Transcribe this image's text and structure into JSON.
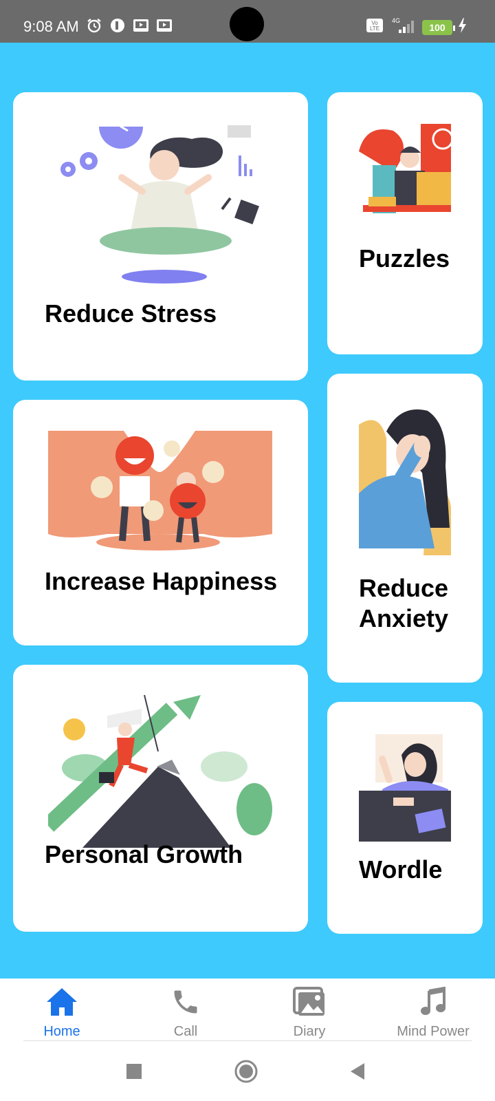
{
  "status_bar": {
    "time": "9:08 AM",
    "battery": "100",
    "network": "4G",
    "volte": "Vo LTE"
  },
  "cards": {
    "reduce_stress": {
      "title": "Reduce Stress",
      "illustration": "meditation-illustration"
    },
    "puzzles": {
      "title": "Puzzles",
      "illustration": "puzzle-desk-illustration"
    },
    "increase_happiness": {
      "title": "Increase Happiness",
      "illustration": "happy-emoji-illustration"
    },
    "reduce_anxiety": {
      "title": "Reduce Anxiety",
      "illustration": "anxious-woman-illustration"
    },
    "personal_growth": {
      "title": "Personal Growth",
      "illustration": "mountain-climb-illustration"
    },
    "wordle": {
      "title": "Wordle",
      "illustration": "reading-woman-illustration"
    }
  },
  "bottom_nav": [
    {
      "label": "Home",
      "icon": "home-icon",
      "active": true
    },
    {
      "label": "Call",
      "icon": "phone-icon",
      "active": false
    },
    {
      "label": "Diary",
      "icon": "gallery-icon",
      "active": false
    },
    {
      "label": "Mind Power",
      "icon": "music-note-icon",
      "active": false
    }
  ],
  "colors": {
    "background": "#3ECAFC",
    "accent": "#1a73e8",
    "card": "#ffffff"
  }
}
